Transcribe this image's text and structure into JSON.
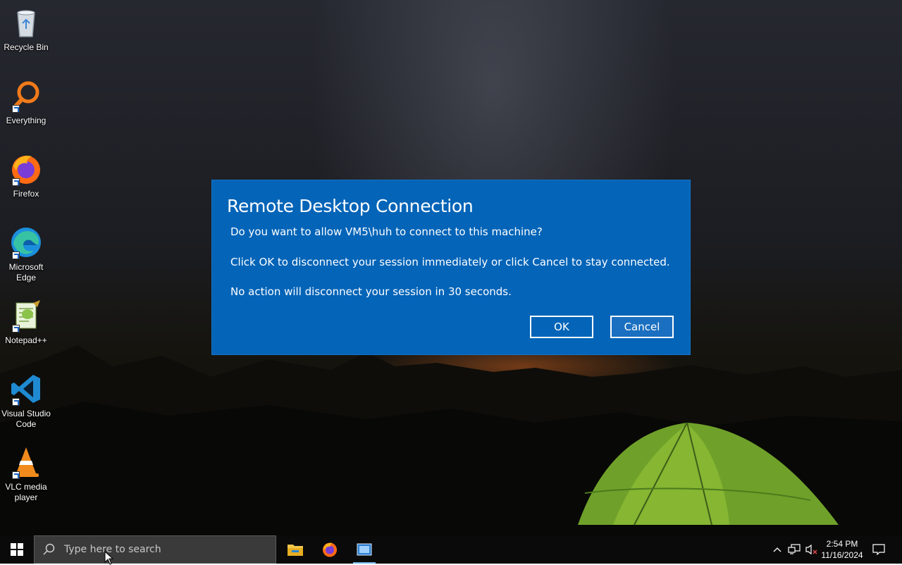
{
  "desktop": {
    "icons": [
      {
        "label": "Recycle Bin",
        "icon": "recycle-bin-icon"
      },
      {
        "label": "Everything",
        "icon": "everything-search-icon"
      },
      {
        "label": "Firefox",
        "icon": "firefox-icon"
      },
      {
        "label": "Microsoft Edge",
        "icon": "edge-icon"
      },
      {
        "label": "Notepad++",
        "icon": "notepadpp-icon"
      },
      {
        "label": "Visual Studio Code",
        "icon": "vscode-icon"
      },
      {
        "label": "VLC media player",
        "icon": "vlc-icon"
      }
    ]
  },
  "dialog": {
    "title": "Remote Desktop Connection",
    "question": "Do you want to allow VM5\\huh to connect to this machine?",
    "instruction": "Click OK to disconnect your session immediately or click Cancel to stay connected.",
    "timeout_notice": "No action will disconnect your session in 30 seconds.",
    "ok_label": "OK",
    "cancel_label": "Cancel",
    "background_color": "#0364b8"
  },
  "taskbar": {
    "search_placeholder": "Type here to search",
    "pinned_apps": [
      "file-explorer-icon",
      "firefox-icon",
      "remote-desktop-icon"
    ],
    "active_app": "remote-desktop-icon",
    "tray_icons": [
      "show-hidden-icons-chevron-icon",
      "network-icon",
      "volume-muted-icon"
    ],
    "time": "2:54 PM",
    "date": "11/16/2024",
    "notification_icon": "action-center-icon"
  }
}
